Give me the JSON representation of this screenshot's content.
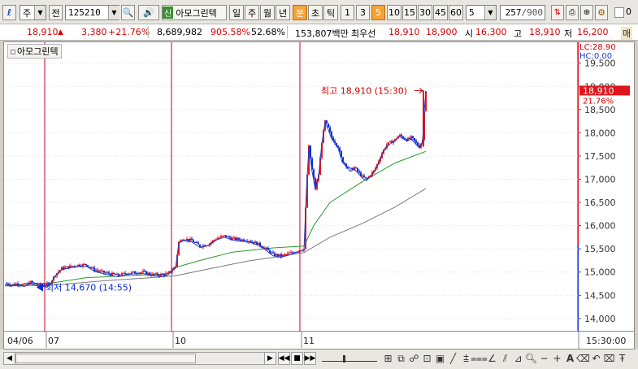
{
  "toolbar": {
    "period_label": "주",
    "market_label": "전",
    "stock_code": "125210",
    "stock_tag": "신",
    "stock_name": "아모그린텍",
    "period_buttons": [
      "일",
      "주",
      "월",
      "년",
      "분",
      "초",
      "틱"
    ],
    "interval_buttons": [
      "1",
      "3",
      "5",
      "10",
      "15",
      "30",
      "45",
      "60"
    ],
    "selected_interval": "5",
    "count_value": "5",
    "page_current": "257",
    "page_total": "/900",
    "checkbox_label": "0"
  },
  "quote": {
    "price": "18,910",
    "change": "3,380",
    "change_pct": "+21.76%",
    "volume": "8,689,982",
    "vol_ratio": "905.58%",
    "turnover_ratio": "52.68%",
    "amount": "153,807백만",
    "priority_label": "최우선",
    "ask": "18,910",
    "bid": "18,900",
    "open_label": "시",
    "open": "16,300",
    "high_label": "고",
    "high": "18,910",
    "low_label": "저",
    "low": "16,200",
    "tail_label": "매"
  },
  "chart": {
    "legend_name": "아모그린텍",
    "max_label": "최고 18,910 (15:30)",
    "min_label": "최저 14,670 (14:55)",
    "lc_label": "LC:28.90",
    "hc_label": "HC:0.00",
    "current_price_label": "18,910",
    "current_pct_label": "21.76%",
    "y_ticks": [
      "19,500",
      "19,000",
      "18,500",
      "18,000",
      "17,500",
      "17,000",
      "16,500",
      "16,000",
      "15,500",
      "15,000",
      "14,500",
      "14,000"
    ],
    "x_ticks": [
      "04/06",
      "07",
      "10",
      "11"
    ],
    "time_label": "15:30:00",
    "colors": {
      "up": "#e8141b",
      "down": "#0b2fd6",
      "ma5": "#1f3cc7",
      "ma20": "#2a9a2a",
      "ma60": "#7a7a7a",
      "divider": "#c8001f"
    }
  },
  "chart_data": {
    "type": "candlestick",
    "ylim": [
      13700,
      19950
    ],
    "sessions": [
      "04/06",
      "04/07",
      "04/10",
      "04/11"
    ],
    "close_path": [
      [
        0,
        14760
      ],
      [
        8,
        14730
      ],
      [
        16,
        14750
      ],
      [
        24,
        14720
      ],
      [
        32,
        14780
      ],
      [
        40,
        14730
      ],
      [
        48,
        14720
      ],
      [
        55,
        14740
      ],
      [
        62,
        14950
      ],
      [
        70,
        15080
      ],
      [
        80,
        15120
      ],
      [
        90,
        15150
      ],
      [
        100,
        15160
      ],
      [
        110,
        15050
      ],
      [
        120,
        15000
      ],
      [
        130,
        14960
      ],
      [
        140,
        14930
      ],
      [
        150,
        14980
      ],
      [
        160,
        14990
      ],
      [
        170,
        15000
      ],
      [
        180,
        14950
      ],
      [
        190,
        14940
      ],
      [
        200,
        14960
      ],
      [
        210,
        15120
      ],
      [
        214,
        15650
      ],
      [
        220,
        15720
      ],
      [
        230,
        15680
      ],
      [
        240,
        15560
      ],
      [
        250,
        15600
      ],
      [
        260,
        15720
      ],
      [
        270,
        15780
      ],
      [
        280,
        15720
      ],
      [
        290,
        15700
      ],
      [
        300,
        15680
      ],
      [
        310,
        15620
      ],
      [
        320,
        15520
      ],
      [
        330,
        15380
      ],
      [
        340,
        15350
      ],
      [
        350,
        15400
      ],
      [
        360,
        15460
      ],
      [
        368,
        15500
      ],
      [
        371,
        16800
      ],
      [
        374,
        17700
      ],
      [
        378,
        17200
      ],
      [
        382,
        16800
      ],
      [
        386,
        17100
      ],
      [
        390,
        17800
      ],
      [
        394,
        18250
      ],
      [
        398,
        18100
      ],
      [
        402,
        17900
      ],
      [
        406,
        17800
      ],
      [
        410,
        17700
      ],
      [
        415,
        17400
      ],
      [
        420,
        17300
      ],
      [
        425,
        17200
      ],
      [
        430,
        17250
      ],
      [
        435,
        17150
      ],
      [
        440,
        17050
      ],
      [
        445,
        17000
      ],
      [
        450,
        17100
      ],
      [
        455,
        17200
      ],
      [
        460,
        17400
      ],
      [
        465,
        17600
      ],
      [
        470,
        17750
      ],
      [
        475,
        17800
      ],
      [
        480,
        17850
      ],
      [
        485,
        17950
      ],
      [
        490,
        17900
      ],
      [
        495,
        17850
      ],
      [
        500,
        17900
      ],
      [
        505,
        17800
      ],
      [
        510,
        17700
      ],
      [
        514,
        17850
      ],
      [
        516,
        18500
      ],
      [
        518,
        18910
      ]
    ],
    "ma20_path": [
      [
        0,
        14720
      ],
      [
        40,
        14750
      ],
      [
        60,
        14770
      ],
      [
        100,
        14880
      ],
      [
        150,
        14920
      ],
      [
        200,
        14960
      ],
      [
        210,
        15100
      ],
      [
        240,
        15250
      ],
      [
        280,
        15430
      ],
      [
        330,
        15520
      ],
      [
        368,
        15560
      ],
      [
        380,
        16000
      ],
      [
        400,
        16500
      ],
      [
        440,
        16950
      ],
      [
        480,
        17350
      ],
      [
        518,
        17600
      ]
    ],
    "ma60_path": [
      [
        0,
        14700
      ],
      [
        60,
        14720
      ],
      [
        120,
        14810
      ],
      [
        180,
        14880
      ],
      [
        210,
        14920
      ],
      [
        260,
        15100
      ],
      [
        300,
        15240
      ],
      [
        340,
        15340
      ],
      [
        368,
        15420
      ],
      [
        400,
        15750
      ],
      [
        440,
        16050
      ],
      [
        480,
        16400
      ],
      [
        518,
        16800
      ]
    ]
  }
}
